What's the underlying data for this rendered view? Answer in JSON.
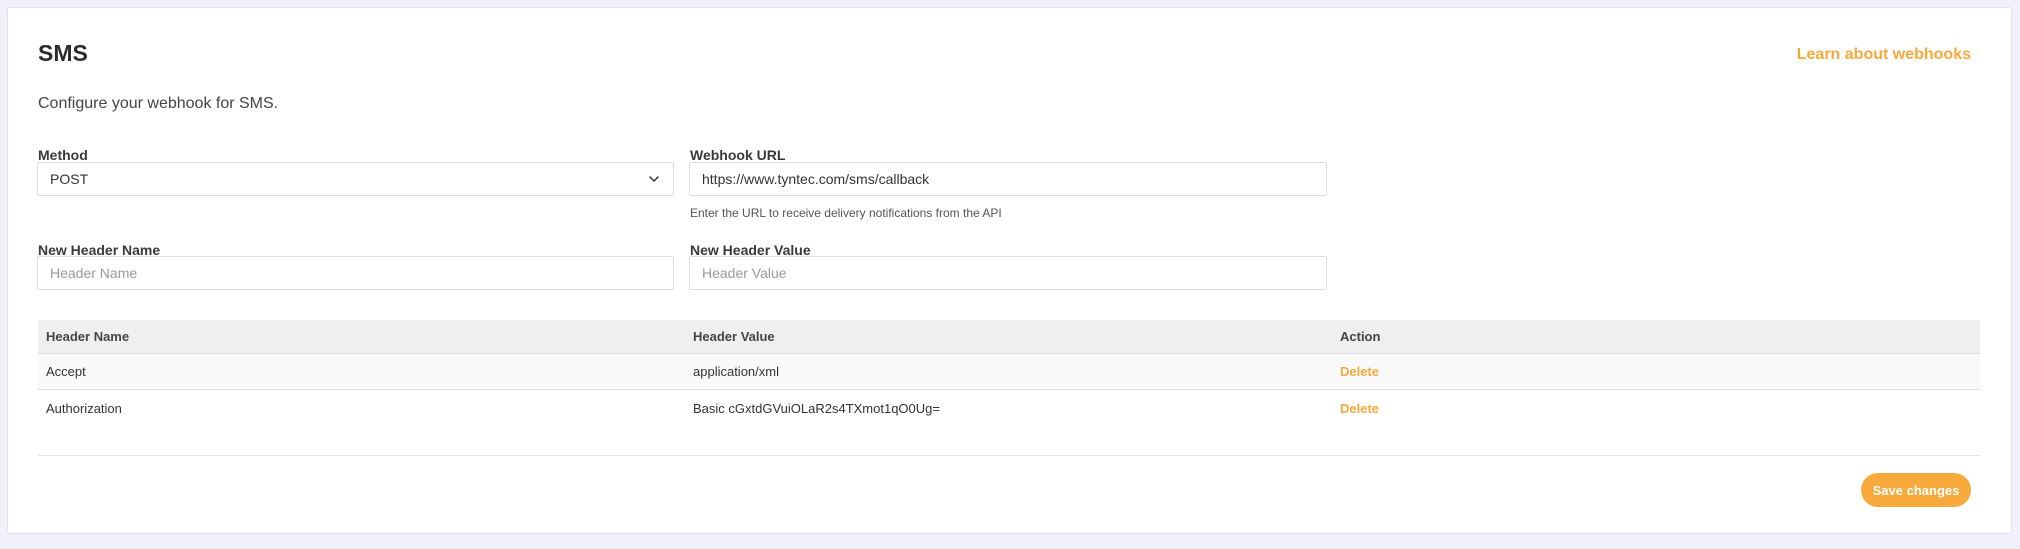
{
  "header": {
    "title": "SMS",
    "learn_link": "Learn about webhooks",
    "subtitle": "Configure your webhook for SMS."
  },
  "form": {
    "method_label": "Method",
    "method_value": "POST",
    "url_label": "Webhook URL",
    "url_value": "https://www.tyntec.com/sms/callback",
    "url_help": "Enter the URL to receive delivery notifications from the API",
    "header_name_label": "New Header Name",
    "header_name_placeholder": "Header Name",
    "header_value_label": "New Header Value",
    "header_value_placeholder": "Header Value"
  },
  "table": {
    "columns": [
      "Header Name",
      "Header Value",
      "Action"
    ],
    "rows": [
      {
        "name": "Accept",
        "value": "application/xml",
        "action": "Delete"
      },
      {
        "name": "Authorization",
        "value": "Basic cGxtdGVuiOLaR2s4TXmot1qO0Ug=",
        "action": "Delete"
      }
    ]
  },
  "footer": {
    "save_label": "Save changes"
  },
  "colors": {
    "accent": "#f7a93b",
    "background": "#f1f0fb"
  },
  "icons": {
    "method_dropdown": "chevron-down-icon"
  }
}
